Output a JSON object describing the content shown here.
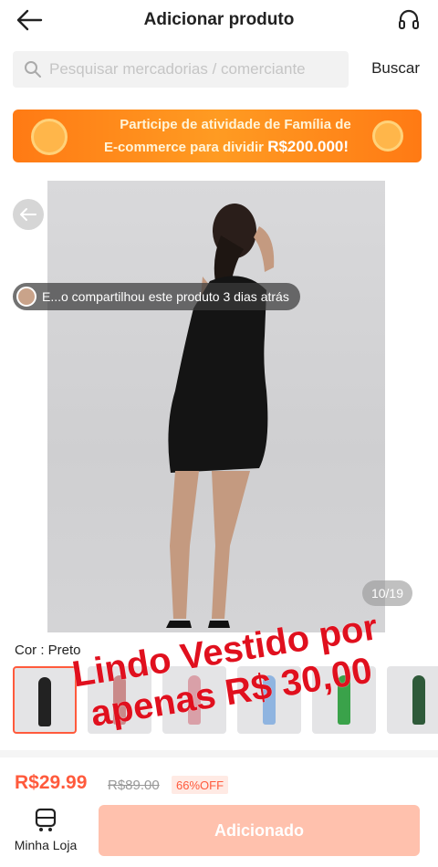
{
  "header": {
    "title": "Adicionar produto"
  },
  "search": {
    "placeholder": "Pesquisar mercadorias / comerciante",
    "button": "Buscar"
  },
  "banner": {
    "line1": "Participe de atividade de Família de",
    "line2_prefix": "E-commerce para dividir ",
    "line2_amount": "R$200.000!"
  },
  "gallery": {
    "counter": "10/19",
    "share_text": "E...o compartilhou este produto 3 dias atrás"
  },
  "color": {
    "label": "Cor : Preto",
    "thumbnails": [
      {
        "fill": "#222222",
        "selected": true
      },
      {
        "fill": "#c98a8a",
        "selected": false
      },
      {
        "fill": "#d9a0a8",
        "selected": false
      },
      {
        "fill": "#8fb4e0",
        "selected": false
      },
      {
        "fill": "#3aa24a",
        "selected": false
      },
      {
        "fill": "#2f5a3a",
        "selected": false
      }
    ]
  },
  "overlay": {
    "line1": "Lindo Vestido por",
    "line2": "apenas R$ 30,00"
  },
  "pricing": {
    "price": "R$29.99",
    "old_price": "R$89.00",
    "discount": "66%OFF"
  },
  "bottom": {
    "my_store": "Minha Loja",
    "add_button": "Adicionado"
  },
  "colors": {
    "accent": "#ff5a3c",
    "banner": "#ff8a1a",
    "overlay_text": "#e0101e"
  }
}
